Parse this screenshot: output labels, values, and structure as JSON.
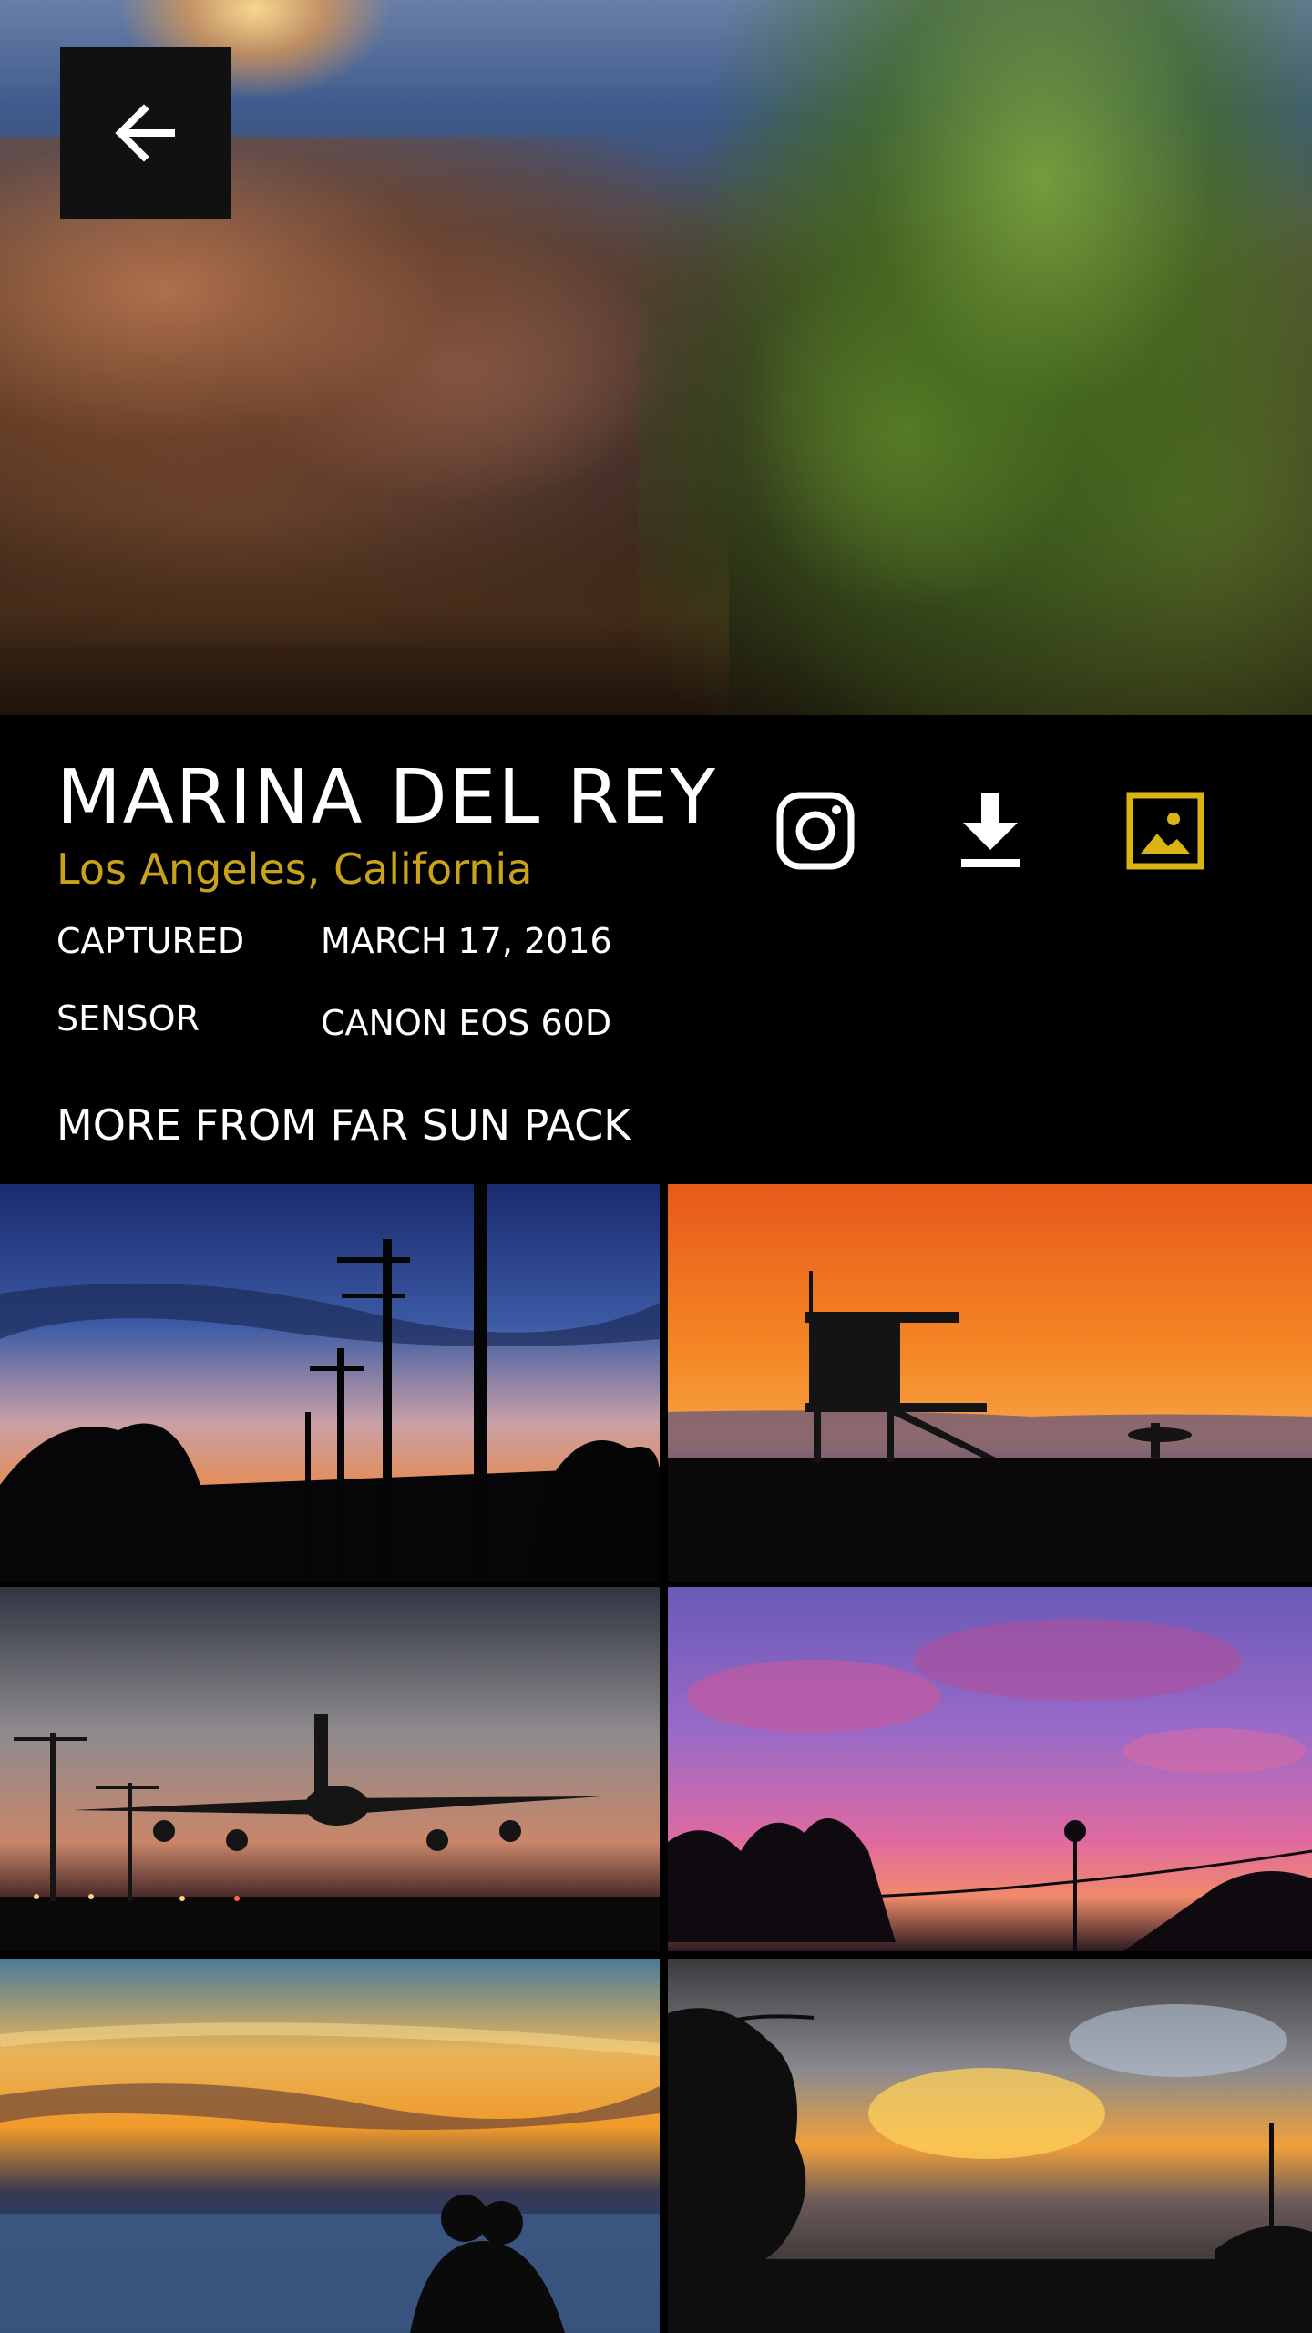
{
  "photo": {
    "title": "MARINA DEL REY",
    "location": "Los Angeles, California",
    "captured_label": "CAPTURED",
    "captured_value": "MARCH 17, 2016",
    "sensor_label": "SENSOR",
    "sensor_value": "CANON EOS 60D"
  },
  "actions": {
    "back": "arrow-left-icon",
    "instagram": "instagram-icon",
    "download": "download-icon",
    "set_wallpaper": "wallpaper-icon"
  },
  "more": {
    "heading": "MORE FROM FAR SUN PACK"
  },
  "colors": {
    "accent": "#d9b414",
    "subtitle": "#c9a21c",
    "background": "#000000"
  }
}
